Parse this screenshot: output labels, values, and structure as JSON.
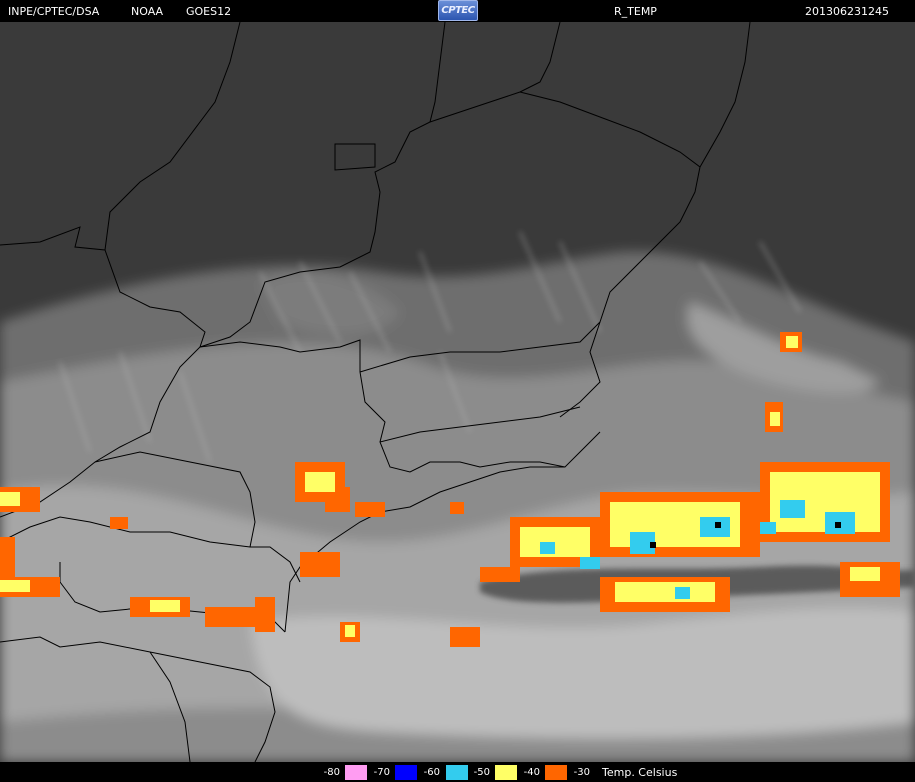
{
  "header": {
    "source": "INPE/CPTEC/DSA",
    "agency": "NOAA",
    "satellite": "GOES12",
    "logo_text": "CPTEC",
    "product": "R_TEMP",
    "timestamp": "201306231245"
  },
  "legend": {
    "items": [
      {
        "label": "-80",
        "color": "#000000"
      },
      {
        "label": "-70",
        "color": "#ff9cf2"
      },
      {
        "label": "-60",
        "color": "#0000ff"
      },
      {
        "label": "-50",
        "color": "#33ccee"
      },
      {
        "label": "-40",
        "color": "#ffff66"
      },
      {
        "label": "-30",
        "color": "#ff6600"
      }
    ],
    "unit_label": "Temp. Celsius"
  },
  "colors": {
    "cloud_bright": "#d0d0d0",
    "cloud_mid": "#9a9a9a",
    "land": "#3c3c3c",
    "borders": "#000000"
  }
}
